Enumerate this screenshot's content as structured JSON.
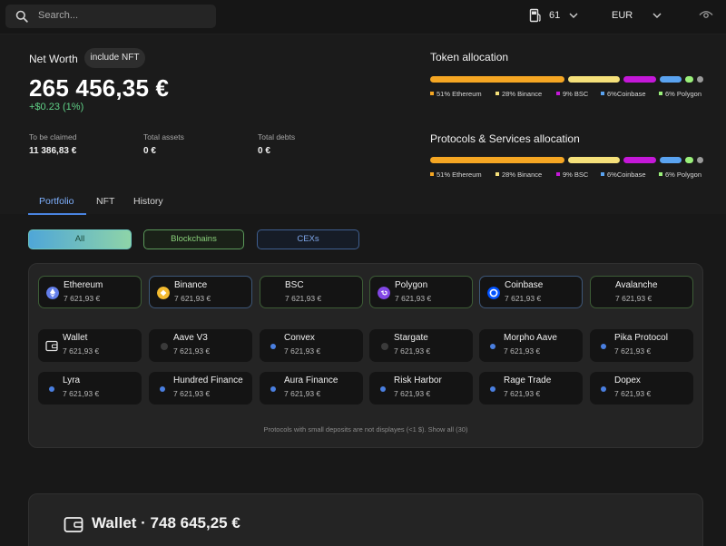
{
  "topbar": {
    "search_placeholder": "Search...",
    "gas_count": "61",
    "currency": "EUR"
  },
  "net_worth": {
    "label": "Net Worth",
    "include_nft": "include NFT",
    "value": "265 456,35 €",
    "change": "+$0.23 (1%)"
  },
  "stats": [
    {
      "label": "To be claimed",
      "value": "11 386,83 €"
    },
    {
      "label": "Total assets",
      "value": "0 €"
    },
    {
      "label": "Total debts",
      "value": "0 €"
    }
  ],
  "token_allocation": {
    "title": "Token allocation",
    "segments": [
      {
        "label": "51% Ethereum",
        "percent": 51,
        "color": "#f5a623"
      },
      {
        "label": "28% Binance",
        "percent": 28,
        "color": "#f5e07a"
      },
      {
        "label": "9% BSC",
        "percent": 9,
        "color": "#c418d8"
      },
      {
        "label": "6%Coinbase",
        "percent": 6,
        "color": "#5aa3f0"
      },
      {
        "label": "6% Polygon",
        "percent": 6,
        "color": "#9af07a"
      }
    ]
  },
  "protocols_allocation": {
    "title": "Protocols & Services allocation",
    "segments": [
      {
        "label": "51% Ethereum",
        "percent": 51,
        "color": "#f5a623"
      },
      {
        "label": "28% Binance",
        "percent": 28,
        "color": "#f5e07a"
      },
      {
        "label": "9% BSC",
        "percent": 9,
        "color": "#c418d8"
      },
      {
        "label": "6%Coinbase",
        "percent": 6,
        "color": "#5aa3f0"
      },
      {
        "label": "6% Polygon",
        "percent": 6,
        "color": "#9af07a"
      }
    ]
  },
  "tabs": [
    {
      "label": "Portfolio",
      "active": true
    },
    {
      "label": "NFT",
      "active": false
    },
    {
      "label": "History",
      "active": false
    }
  ],
  "filters": {
    "all": "All",
    "blockchains": "Blockchains",
    "cexs": "CEXs"
  },
  "chains": [
    {
      "name": "Ethereum",
      "value": "7 621,93 €",
      "icon": "ethereum-icon",
      "color": "#627eea"
    },
    {
      "name": "Binance",
      "value": "7 621,93 €",
      "icon": "binance-icon",
      "color": "#f3ba2f"
    },
    {
      "name": "BSC",
      "value": "7 621,93 €",
      "icon": "",
      "color": ""
    },
    {
      "name": "Polygon",
      "value": "7 621,93 €",
      "icon": "polygon-icon",
      "color": "#8247e5"
    },
    {
      "name": "Coinbase",
      "value": "7 621,93 €",
      "icon": "coinbase-icon",
      "color": "#0052ff"
    },
    {
      "name": "Avalanche",
      "value": "7 621,93 €",
      "icon": "",
      "color": ""
    }
  ],
  "protocols_row1": [
    {
      "name": "Wallet",
      "value": "7 621,93 €",
      "icon": "wallet-icon"
    },
    {
      "name": "Aave V3",
      "value": "7 621,93 €",
      "icon": "dot-dark"
    },
    {
      "name": "Convex",
      "value": "7 621,93 €",
      "icon": "dot-blue"
    },
    {
      "name": "Stargate",
      "value": "7 621,93 €",
      "icon": "dot-dark"
    },
    {
      "name": "Morpho Aave",
      "value": "7 621,93 €",
      "icon": "dot-blue"
    },
    {
      "name": "Pika Protocol",
      "value": "7 621,93 €",
      "icon": "dot-blue"
    }
  ],
  "protocols_row2": [
    {
      "name": "Lyra",
      "value": "7 621,93 €",
      "icon": "dot-blue"
    },
    {
      "name": "Hundred Finance",
      "value": "7 621,93 €",
      "icon": "dot-blue"
    },
    {
      "name": "Aura Finance",
      "value": "7 621,93 €",
      "icon": "dot-blue"
    },
    {
      "name": "Risk Harbor",
      "value": "7 621,93 €",
      "icon": "dot-blue"
    },
    {
      "name": "Rage Trade",
      "value": "7 621,93 €",
      "icon": "dot-blue"
    },
    {
      "name": "Dopex",
      "value": "7 621,93 €",
      "icon": "dot-blue"
    }
  ],
  "panel_note": "Protocols with small deposits are not displayes (<1 $). Show all (30)",
  "wallet_section": {
    "title": "Wallet · 748 645,25 €"
  }
}
